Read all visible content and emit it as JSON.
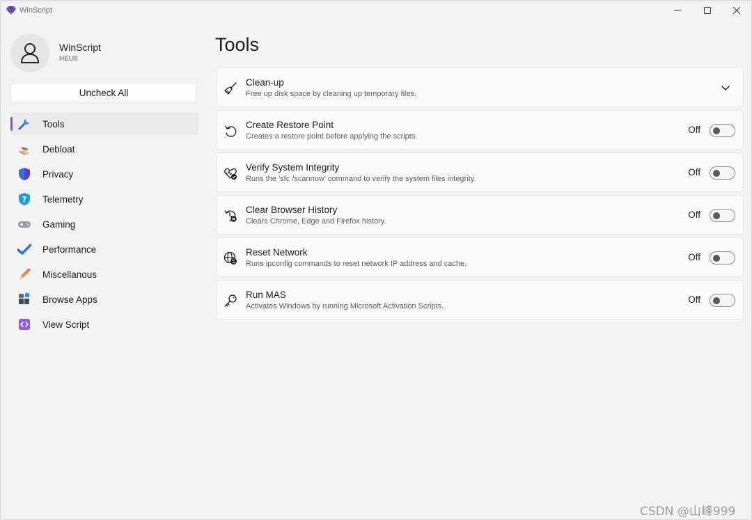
{
  "window": {
    "title": "WinScript"
  },
  "profile": {
    "name": "WinScript",
    "subtitle": "HEU8"
  },
  "sidebar": {
    "uncheck_label": "Uncheck All",
    "items": [
      {
        "label": "Tools",
        "icon": "wrench-icon",
        "active": true
      },
      {
        "label": "Debloat",
        "icon": "broom-icon"
      },
      {
        "label": "Privacy",
        "icon": "shield-icon"
      },
      {
        "label": "Telemetry",
        "icon": "shield-question-icon"
      },
      {
        "label": "Gaming",
        "icon": "gamepad-icon"
      },
      {
        "label": "Performance",
        "icon": "checkmark-icon"
      },
      {
        "label": "Miscellanous",
        "icon": "pencil-icon"
      },
      {
        "label": "Browse Apps",
        "icon": "apps-icon"
      },
      {
        "label": "View Script",
        "icon": "code-icon"
      }
    ]
  },
  "main": {
    "title": "Tools",
    "tools": [
      {
        "title": "Clean-up",
        "desc": "Free up disk space by cleaning up temporary files.",
        "icon": "broom-icon",
        "expandable": true
      },
      {
        "title": "Create Restore Point",
        "desc": "Creates a restore point before applying the scripts.",
        "icon": "undo-icon",
        "state": "Off"
      },
      {
        "title": "Verify System Integrity",
        "desc": "Runs the 'sfc /scannow' command to verify the system files integrity.",
        "icon": "heart-check-icon",
        "state": "Off"
      },
      {
        "title": "Clear Browser History",
        "desc": "Clears Chrome, Edge and Firefox history.",
        "icon": "history-clear-icon",
        "state": "Off"
      },
      {
        "title": "Reset Network",
        "desc": "Runs ipconfig commands to reset network IP address and cache.",
        "icon": "globe-sync-icon",
        "state": "Off"
      },
      {
        "title": "Run MAS",
        "desc": "Activates Windows by running Microsoft Activation Scripts.",
        "icon": "key-icon",
        "state": "Off"
      }
    ]
  },
  "watermark": "CSDN @山峰999",
  "colors": {
    "accent": "#7c5cbf",
    "background": "#f3f3f3",
    "card": "#fbfbfb"
  }
}
